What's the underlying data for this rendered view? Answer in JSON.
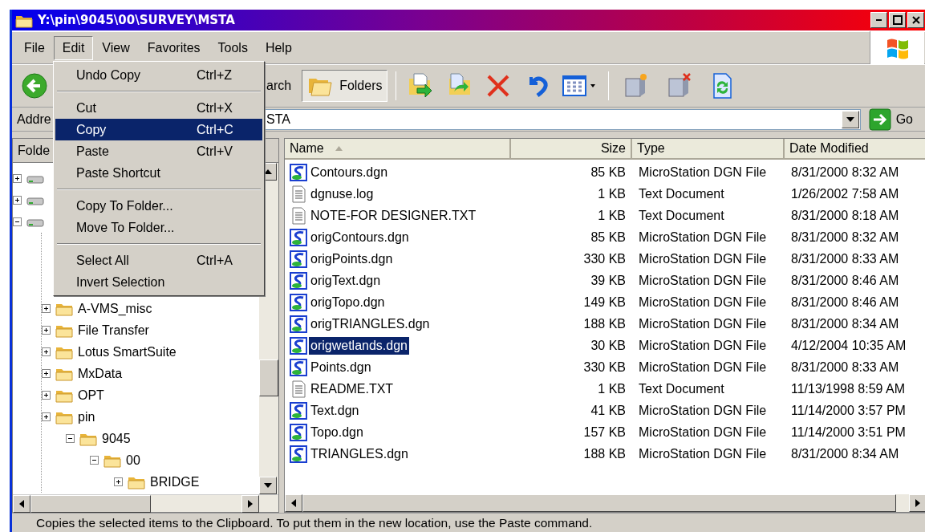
{
  "window": {
    "title": "Y:\\pin\\9045\\00\\SURVEY\\MSTA"
  },
  "menu_bar": [
    {
      "label": "File",
      "selected": false
    },
    {
      "label": "Edit",
      "selected": true
    },
    {
      "label": "View",
      "selected": false
    },
    {
      "label": "Favorites",
      "selected": false
    },
    {
      "label": "Tools",
      "selected": false
    },
    {
      "label": "Help",
      "selected": false
    }
  ],
  "edit_menu": [
    {
      "kind": "item",
      "label": "Undo Copy",
      "shortcut": "Ctrl+Z",
      "selected": false
    },
    {
      "kind": "separator"
    },
    {
      "kind": "item",
      "label": "Cut",
      "shortcut": "Ctrl+X",
      "selected": false
    },
    {
      "kind": "item",
      "label": "Copy",
      "shortcut": "Ctrl+C",
      "selected": true
    },
    {
      "kind": "item",
      "label": "Paste",
      "shortcut": "Ctrl+V",
      "selected": false
    },
    {
      "kind": "item",
      "label": "Paste Shortcut",
      "selected": false
    },
    {
      "kind": "separator"
    },
    {
      "kind": "item",
      "label": "Copy To Folder...",
      "selected": false
    },
    {
      "kind": "item",
      "label": "Move To Folder...",
      "selected": false
    },
    {
      "kind": "separator"
    },
    {
      "kind": "item",
      "label": "Select All",
      "shortcut": "Ctrl+A",
      "selected": false
    },
    {
      "kind": "item",
      "label": "Invert Selection",
      "selected": false
    }
  ],
  "toolbar": {
    "search_label": "arch",
    "folders_label": "Folders",
    "folders_pressed": true
  },
  "address_bar": {
    "label": "Addre",
    "value": "STA",
    "go_label": "Go"
  },
  "folder_pane": {
    "title": "Folde",
    "tree": [
      {
        "kind": "drive",
        "expanded": false
      },
      {
        "kind": "drive",
        "expanded": false
      },
      {
        "kind": "drive",
        "expanded": true,
        "children": [
          {
            "kind": "folder",
            "label": "A-VMS_misc",
            "expanded": false
          },
          {
            "kind": "folder",
            "label": "File Transfer",
            "expanded": false
          },
          {
            "kind": "folder",
            "label": "Lotus SmartSuite",
            "expanded": false
          },
          {
            "kind": "folder",
            "label": "MxData",
            "expanded": false
          },
          {
            "kind": "folder",
            "label": "OPT",
            "expanded": false
          },
          {
            "kind": "folder",
            "label": "pin",
            "expanded": false,
            "children": [
              {
                "kind": "folder",
                "label": "9045",
                "expanded": true,
                "children": [
                  {
                    "kind": "folder",
                    "label": "00",
                    "expanded": true,
                    "children": [
                      {
                        "kind": "folder",
                        "label": "BRIDGE",
                        "expanded": false
                      }
                    ]
                  }
                ]
              }
            ]
          }
        ]
      }
    ]
  },
  "file_list": {
    "columns": [
      {
        "label": "Name",
        "sorted": true
      },
      {
        "label": "Size",
        "sorted": false
      },
      {
        "label": "Type",
        "sorted": false
      },
      {
        "label": "Date Modified",
        "sorted": false
      }
    ],
    "rows": [
      {
        "kind": "dgn",
        "name": "Contours.dgn",
        "size": "85 KB",
        "type": "MicroStation DGN File",
        "date": "8/31/2000 8:32 AM",
        "selected": false
      },
      {
        "kind": "text",
        "name": "dgnuse.log",
        "size": "1 KB",
        "type": "Text Document",
        "date": "1/26/2002 7:58 AM",
        "selected": false
      },
      {
        "kind": "text",
        "name": "NOTE-FOR DESIGNER.TXT",
        "size": "1 KB",
        "type": "Text Document",
        "date": "8/31/2000 8:18 AM",
        "selected": false
      },
      {
        "kind": "dgn",
        "name": "origContours.dgn",
        "size": "85 KB",
        "type": "MicroStation DGN File",
        "date": "8/31/2000 8:32 AM",
        "selected": false
      },
      {
        "kind": "dgn",
        "name": "origPoints.dgn",
        "size": "330 KB",
        "type": "MicroStation DGN File",
        "date": "8/31/2000 8:33 AM",
        "selected": false
      },
      {
        "kind": "dgn",
        "name": "origText.dgn",
        "size": "39 KB",
        "type": "MicroStation DGN File",
        "date": "8/31/2000 8:46 AM",
        "selected": false
      },
      {
        "kind": "dgn",
        "name": "origTopo.dgn",
        "size": "149 KB",
        "type": "MicroStation DGN File",
        "date": "8/31/2000 8:46 AM",
        "selected": false
      },
      {
        "kind": "dgn",
        "name": "origTRIANGLES.dgn",
        "size": "188 KB",
        "type": "MicroStation DGN File",
        "date": "8/31/2000 8:34 AM",
        "selected": false
      },
      {
        "kind": "dgn",
        "name": "origwetlands.dgn",
        "size": "30 KB",
        "type": "MicroStation DGN File",
        "date": "4/12/2004 10:35 AM",
        "selected": true
      },
      {
        "kind": "dgn",
        "name": "Points.dgn",
        "size": "330 KB",
        "type": "MicroStation DGN File",
        "date": "8/31/2000 8:33 AM",
        "selected": false
      },
      {
        "kind": "text",
        "name": "README.TXT",
        "size": "1 KB",
        "type": "Text Document",
        "date": "11/13/1998 8:59 AM",
        "selected": false
      },
      {
        "kind": "dgn",
        "name": "Text.dgn",
        "size": "41 KB",
        "type": "MicroStation DGN File",
        "date": "11/14/2000 3:57 PM",
        "selected": false
      },
      {
        "kind": "dgn",
        "name": "Topo.dgn",
        "size": "157 KB",
        "type": "MicroStation DGN File",
        "date": "11/14/2000 3:51 PM",
        "selected": false
      },
      {
        "kind": "dgn",
        "name": "TRIANGLES.dgn",
        "size": "188 KB",
        "type": "MicroStation DGN File",
        "date": "8/31/2000 8:34 AM",
        "selected": false
      }
    ]
  },
  "status_bar": "Copies the selected items to the Clipboard. To put them in the new location, use the Paste command."
}
